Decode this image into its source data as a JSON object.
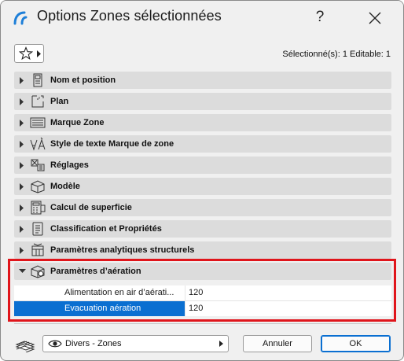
{
  "window": {
    "title": "Options Zones sélectionnées",
    "help_label": "?",
    "selection_info": "Sélectionné(s): 1 Editable: 1"
  },
  "panels": [
    {
      "label": "Nom et position",
      "icon": "name-position-icon"
    },
    {
      "label": "Plan",
      "icon": "floor-plan-icon"
    },
    {
      "label": "Marque Zone",
      "icon": "zone-stamp-icon"
    },
    {
      "label": "Style de texte Marque de zone",
      "icon": "text-style-icon"
    },
    {
      "label": "Réglages",
      "icon": "settings-icon"
    },
    {
      "label": "Modèle",
      "icon": "model-icon"
    },
    {
      "label": "Calcul de superficie",
      "icon": "area-calculation-icon"
    },
    {
      "label": "Classification et Propriétés",
      "icon": "classification-icon"
    },
    {
      "label": "Paramètres analytiques structurels",
      "icon": "structural-analysis-icon"
    },
    {
      "label": "Paramètres d’aération",
      "icon": "ventilation-icon",
      "expanded": true
    }
  ],
  "ventilation_properties": [
    {
      "name": "Alimentation en air d’aérati...",
      "value": "120",
      "selected": false
    },
    {
      "name": "Evacuation aération",
      "value": "120",
      "selected": true
    }
  ],
  "footer": {
    "view_select_value": "Divers - Zones",
    "cancel_label": "Annuler",
    "ok_label": "OK"
  },
  "colors": {
    "accent": "#0a6fd1",
    "highlight_border": "#e0151b",
    "panel_header": "#dcdcdc"
  }
}
